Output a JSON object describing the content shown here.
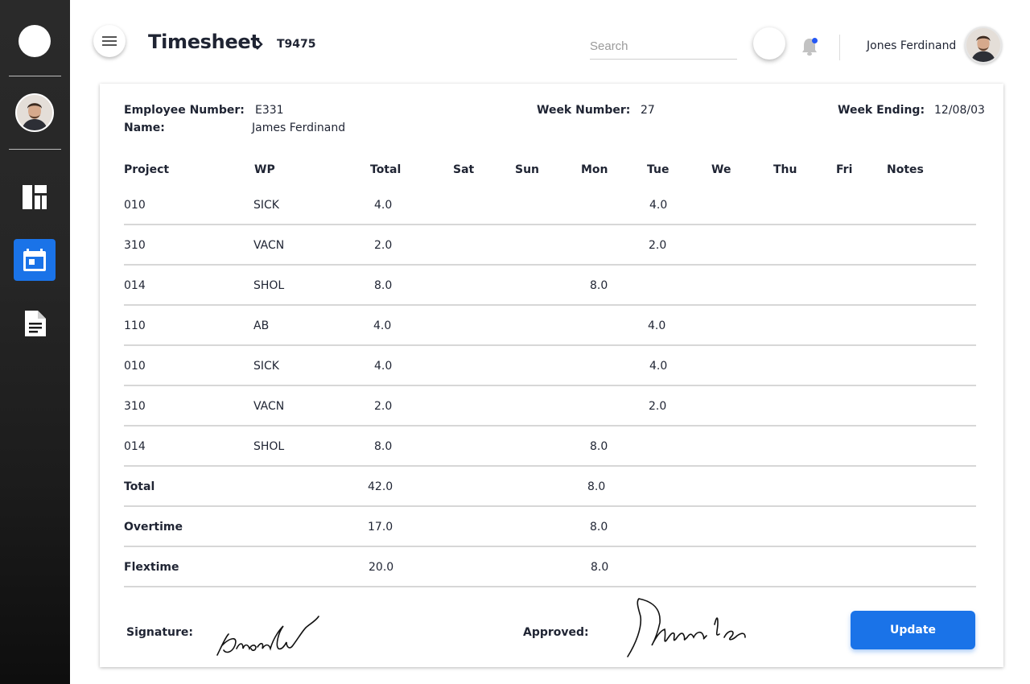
{
  "header": {
    "title": "Timesheet",
    "code": "T9475",
    "search_placeholder": "Search",
    "user_name": "Jones Ferdinand"
  },
  "sidebar": {
    "items": [
      {
        "icon": "dashboard-icon"
      },
      {
        "icon": "calendar-icon",
        "active": true
      },
      {
        "icon": "document-icon"
      }
    ]
  },
  "info": {
    "employee_number_label": "Employee Number:",
    "employee_number": "E331",
    "name_label": "Name:",
    "name": "James Ferdinand",
    "week_number_label": "Week Number:",
    "week_number": "27",
    "week_ending_label": "Week Ending:",
    "week_ending": "12/08/03"
  },
  "table": {
    "columns": [
      "Project",
      "WP",
      "Total",
      "Sat",
      "Sun",
      "Mon",
      "Tue",
      "We",
      "Thu",
      "Fri",
      "Notes"
    ],
    "rows": [
      {
        "project": "010",
        "wp": "SICK",
        "total": "4.0",
        "mon": "",
        "tue": "4.0"
      },
      {
        "project": "310",
        "wp": "VACN",
        "total": "2.0",
        "mon": "",
        "tue": "2.0"
      },
      {
        "project": "014",
        "wp": "SHOL",
        "total": "8.0",
        "mon": "8.0",
        "tue": ""
      },
      {
        "project": "110",
        "wp": "AB",
        "total": "4.0",
        "mon": "",
        "tue": "4.0"
      },
      {
        "project": "010",
        "wp": "SICK",
        "total": "4.0",
        "mon": "",
        "tue": "4.0"
      },
      {
        "project": "310",
        "wp": "VACN",
        "total": "2.0",
        "mon": "",
        "tue": "2.0"
      },
      {
        "project": "014",
        "wp": "SHOL",
        "total": "8.0",
        "mon": "8.0",
        "tue": ""
      }
    ],
    "summary": [
      {
        "label": "Total",
        "total": "42.0",
        "mon": "8.0"
      },
      {
        "label": "Overtime",
        "total": "17.0",
        "mon": "8.0"
      },
      {
        "label": "Flextime",
        "total": "20.0",
        "mon": "8.0"
      }
    ]
  },
  "footer": {
    "signature_label": "Signature:",
    "approved_label": "Approved:",
    "update_label": "Update"
  },
  "colors": {
    "accent": "#1a73e8",
    "notification_dot": "#2457f5"
  }
}
